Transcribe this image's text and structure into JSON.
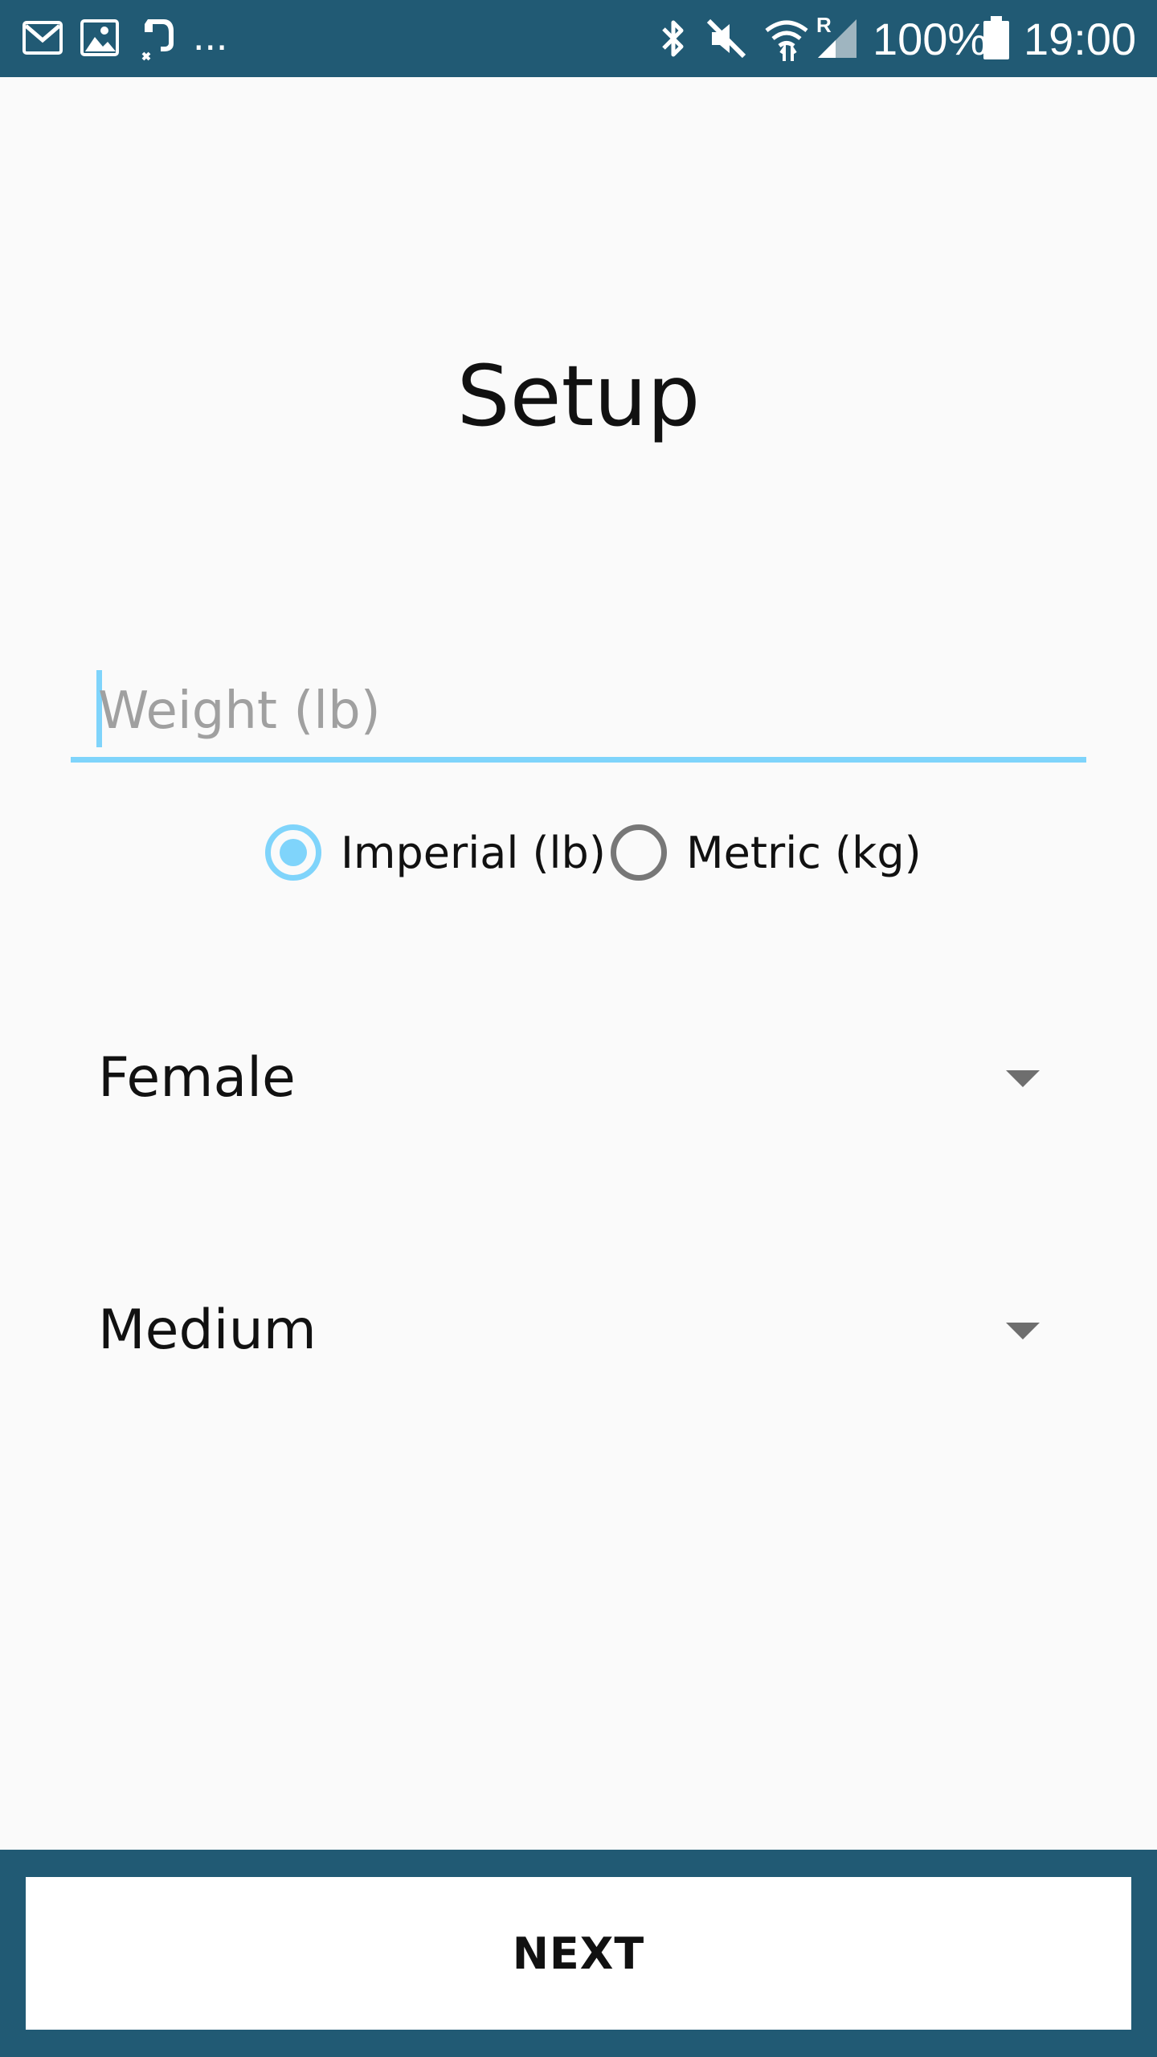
{
  "status_bar": {
    "notification_icons": [
      "gmail-icon",
      "gallery-icon",
      "evernote-icon"
    ],
    "more_notifications": "...",
    "system_icons": [
      "bluetooth-icon",
      "mute-icon",
      "wifi-icon",
      "signal-icon",
      "battery-icon"
    ],
    "roaming_indicator": "R",
    "battery_percent": "100%",
    "time": "19:00"
  },
  "screen": {
    "title": "Setup"
  },
  "weight_input": {
    "placeholder": "Weight (lb)",
    "value": ""
  },
  "unit_options": [
    {
      "label": "Imperial (lb)",
      "selected": true
    },
    {
      "label": "Metric (kg)",
      "selected": false
    }
  ],
  "gender_spinner": {
    "selected": "Female"
  },
  "size_spinner": {
    "selected": "Medium"
  },
  "footer": {
    "next_label": "NEXT"
  },
  "colors": {
    "status_bar_bg": "#215a74",
    "accent": "#7fd4fb",
    "background": "#fafafa"
  }
}
